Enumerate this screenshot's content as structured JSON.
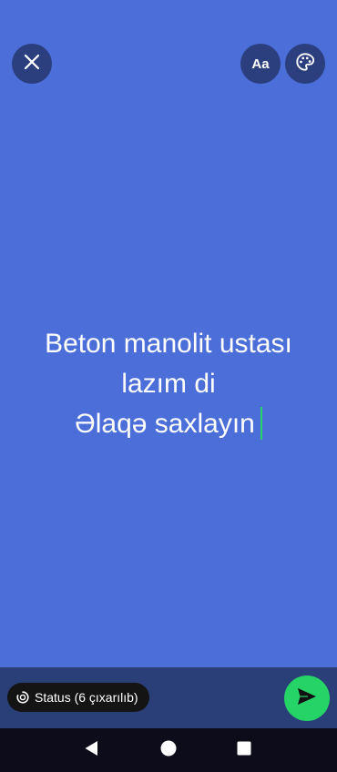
{
  "header": {
    "close_icon": "close-icon",
    "font_button_label": "Aa",
    "palette_icon": "palette-icon"
  },
  "status_text": {
    "lines": [
      "Beton manolit ustası",
      "lazım di",
      "Əlaqə saxlayın"
    ]
  },
  "footer": {
    "audience_label": "Status (6 çıxarılıb)",
    "audience_icon": "status-ring-icon",
    "send_icon": "send-icon"
  },
  "colors": {
    "background": "#4B6ED8",
    "caret": "#25D366",
    "send_button": "#25D366",
    "bottom_bar": "#2A3F78",
    "nav_bar": "#0C0C1A"
  },
  "nav": {
    "back_icon": "back-icon",
    "home_icon": "home-icon",
    "recents_icon": "recents-icon"
  }
}
